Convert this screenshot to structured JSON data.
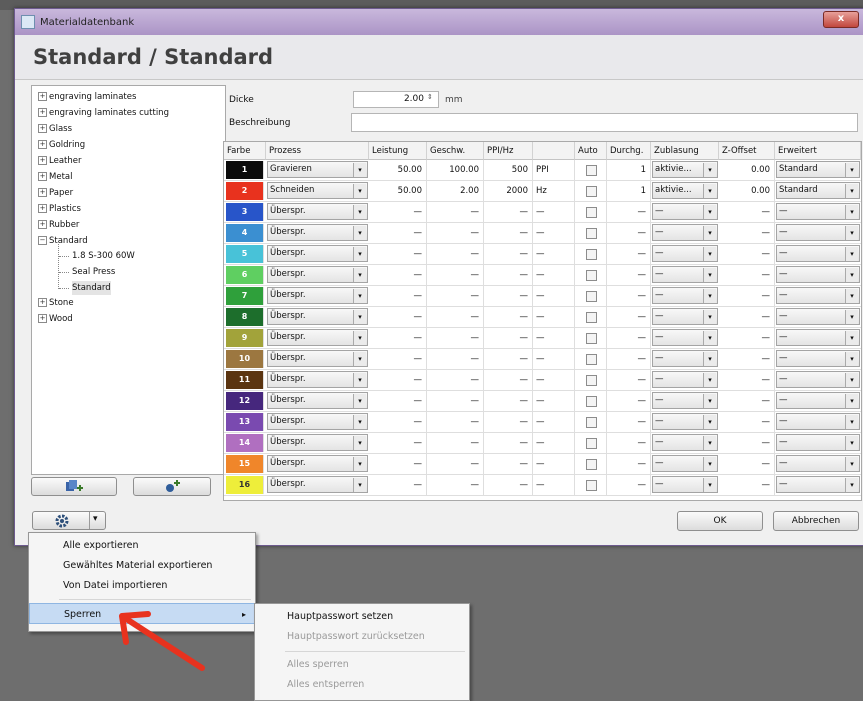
{
  "window": {
    "title": "Materialdatenbank",
    "close_glyph": "x",
    "header": "Standard / Standard"
  },
  "tree": {
    "items": [
      {
        "label": "engraving laminates",
        "sign": "+"
      },
      {
        "label": "engraving laminates cutting",
        "sign": "+"
      },
      {
        "label": "Glass",
        "sign": "+"
      },
      {
        "label": "Goldring",
        "sign": "+"
      },
      {
        "label": "Leather",
        "sign": "+"
      },
      {
        "label": "Metal",
        "sign": "+"
      },
      {
        "label": "Paper",
        "sign": "+"
      },
      {
        "label": "Plastics",
        "sign": "+"
      },
      {
        "label": "Rubber",
        "sign": "+"
      },
      {
        "label": "Standard",
        "sign": "−"
      },
      {
        "label": "Stone",
        "sign": "+"
      },
      {
        "label": "Wood",
        "sign": "+"
      }
    ],
    "children": [
      "1.8 S-300 60W",
      "Seal Press",
      "Standard"
    ]
  },
  "form": {
    "dicke_label": "Dicke",
    "dicke_value": "2.00",
    "dicke_unit": "mm",
    "beschreibung_label": "Beschreibung",
    "beschreibung_value": ""
  },
  "table": {
    "headers": [
      "Farbe",
      "Prozess",
      "Leistung",
      "Geschw.",
      "PPI/Hz",
      "",
      "Auto",
      "Durchg.",
      "Zublasung",
      "Z-Offset",
      "Erweitert"
    ],
    "rows": [
      {
        "n": "1",
        "color": "#0b0b0b",
        "prozess": "Gravieren",
        "leistung": "50.00",
        "geschw": "100.00",
        "ppi": "500",
        "unit": "PPI",
        "durchg": "1",
        "zublasung": "aktivie...",
        "zoffset": "0.00",
        "erweitert": "Standard"
      },
      {
        "n": "2",
        "color": "#e8321e",
        "prozess": "Schneiden",
        "leistung": "50.00",
        "geschw": "2.00",
        "ppi": "2000",
        "unit": "Hz",
        "durchg": "1",
        "zublasung": "aktivie...",
        "zoffset": "0.00",
        "erweitert": "Standard"
      },
      {
        "n": "3",
        "color": "#2855c9",
        "prozess": "Überspr.",
        "leistung": "—",
        "geschw": "—",
        "ppi": "—",
        "unit": "—",
        "durchg": "—",
        "zublasung": "—",
        "zoffset": "—",
        "erweitert": "—"
      },
      {
        "n": "4",
        "color": "#3b8fd1",
        "prozess": "Überspr.",
        "leistung": "—",
        "geschw": "—",
        "ppi": "—",
        "unit": "—",
        "durchg": "—",
        "zublasung": "—",
        "zoffset": "—",
        "erweitert": "—"
      },
      {
        "n": "5",
        "color": "#48c2d8",
        "prozess": "Überspr.",
        "leistung": "—",
        "geschw": "—",
        "ppi": "—",
        "unit": "—",
        "durchg": "—",
        "zublasung": "—",
        "zoffset": "—",
        "erweitert": "—"
      },
      {
        "n": "6",
        "color": "#5fcf61",
        "prozess": "Überspr.",
        "leistung": "—",
        "geschw": "—",
        "ppi": "—",
        "unit": "—",
        "durchg": "—",
        "zublasung": "—",
        "zoffset": "—",
        "erweitert": "—"
      },
      {
        "n": "7",
        "color": "#2fa03b",
        "prozess": "Überspr.",
        "leistung": "—",
        "geschw": "—",
        "ppi": "—",
        "unit": "—",
        "durchg": "—",
        "zublasung": "—",
        "zoffset": "—",
        "erweitert": "—"
      },
      {
        "n": "8",
        "color": "#1d6e2c",
        "prozess": "Überspr.",
        "leistung": "—",
        "geschw": "—",
        "ppi": "—",
        "unit": "—",
        "durchg": "—",
        "zublasung": "—",
        "zoffset": "—",
        "erweitert": "—"
      },
      {
        "n": "9",
        "color": "#a2a33a",
        "prozess": "Überspr.",
        "leistung": "—",
        "geschw": "—",
        "ppi": "—",
        "unit": "—",
        "durchg": "—",
        "zublasung": "—",
        "zoffset": "—",
        "erweitert": "—"
      },
      {
        "n": "10",
        "color": "#9c7740",
        "prozess": "Überspr.",
        "leistung": "—",
        "geschw": "—",
        "ppi": "—",
        "unit": "—",
        "durchg": "—",
        "zublasung": "—",
        "zoffset": "—",
        "erweitert": "—"
      },
      {
        "n": "11",
        "color": "#5b3511",
        "prozess": "Überspr.",
        "leistung": "—",
        "geschw": "—",
        "ppi": "—",
        "unit": "—",
        "durchg": "—",
        "zublasung": "—",
        "zoffset": "—",
        "erweitert": "—"
      },
      {
        "n": "12",
        "color": "#46277d",
        "prozess": "Überspr.",
        "leistung": "—",
        "geschw": "—",
        "ppi": "—",
        "unit": "—",
        "durchg": "—",
        "zublasung": "—",
        "zoffset": "—",
        "erweitert": "—"
      },
      {
        "n": "13",
        "color": "#7a4ab0",
        "prozess": "Überspr.",
        "leistung": "—",
        "geschw": "—",
        "ppi": "—",
        "unit": "—",
        "durchg": "—",
        "zublasung": "—",
        "zoffset": "—",
        "erweitert": "—"
      },
      {
        "n": "14",
        "color": "#b06fc0",
        "prozess": "Überspr.",
        "leistung": "—",
        "geschw": "—",
        "ppi": "—",
        "unit": "—",
        "durchg": "—",
        "zublasung": "—",
        "zoffset": "—",
        "erweitert": "—"
      },
      {
        "n": "15",
        "color": "#f0862a",
        "prozess": "Überspr.",
        "leistung": "—",
        "geschw": "—",
        "ppi": "—",
        "unit": "—",
        "durchg": "—",
        "zublasung": "—",
        "zoffset": "—",
        "erweitert": "—"
      },
      {
        "n": "16",
        "color": "#eeee3a",
        "prozess": "Überspr.",
        "leistung": "—",
        "geschw": "—",
        "ppi": "—",
        "unit": "—",
        "durchg": "—",
        "zublasung": "—",
        "zoffset": "—",
        "erweitert": "—"
      }
    ]
  },
  "buttons": {
    "ok": "OK",
    "cancel": "Abbrechen",
    "settings_icon": "gear-icon",
    "dropdown_glyph": "▾"
  },
  "menu": {
    "items": [
      "Alle exportieren",
      "Gewähltes Material exportieren",
      "Von Datei importieren",
      "Sperren"
    ],
    "submenu_arrow": "▸",
    "submenu": [
      {
        "label": "Hauptpasswort setzen",
        "enabled": true
      },
      {
        "label": "Hauptpasswort zurücksetzen",
        "enabled": false
      },
      {
        "label": "Alles sperren",
        "enabled": false
      },
      {
        "label": "Alles entsperren",
        "enabled": false
      }
    ]
  },
  "colors": {
    "title_bar": "#b9a4d1",
    "highlight": "#c6dbf3",
    "arrow": "#e8321e"
  }
}
